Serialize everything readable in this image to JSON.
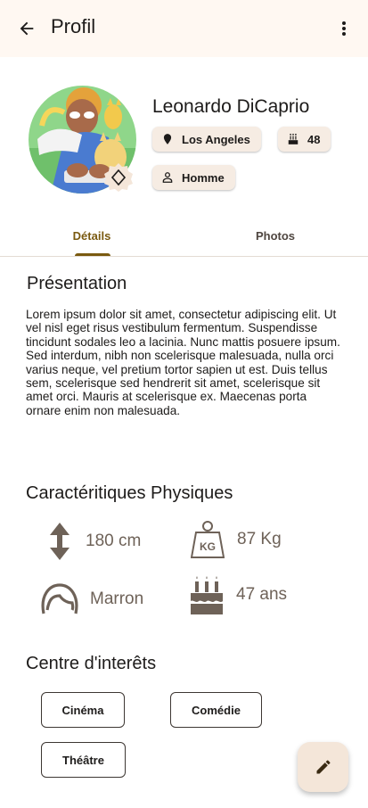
{
  "appbar": {
    "title": "Profil",
    "back_icon": "arrow-left-icon",
    "menu_icon": "more-vert-icon"
  },
  "profile": {
    "name": "Leonardo DiCaprio",
    "avatar_icon": "memoji-avatar",
    "avatar_badge_icon": "edit-photo-icon",
    "chips": {
      "location": {
        "label": "Los Angeles",
        "icon": "location-pin-icon"
      },
      "age": {
        "label": "48",
        "icon": "cake-icon"
      },
      "gender": {
        "label": "Homme",
        "icon": "person-icon"
      }
    }
  },
  "tabs": [
    {
      "label": "Détails",
      "active": true
    },
    {
      "label": "Photos",
      "active": false
    }
  ],
  "presentation": {
    "title": "Présentation",
    "text": "Lorem ipsum dolor sit amet, consectetur adipiscing elit. Ut vel nisl eget risus vestibulum fermentum. Suspendisse tincidunt sodales leo a lacinia. Nunc mattis posuere ipsum. Sed interdum, nibh non scelerisque malesuada, nulla orci varius neque, vel pretium tortor sapien ut est. Duis tellus sem, scelerisque sed hendrerit sit amet, scelerisque sit amet orci. Mauris at scelerisque ex. Maecenas porta ornare enim non malesuada."
  },
  "physical": {
    "title": "Caractéritiques Physiques",
    "height": "180 cm",
    "weight": "87 Kg",
    "hair": "Marron",
    "age": "47 ans"
  },
  "interests": {
    "title": "Centre d'interêts",
    "items": [
      "Cinéma",
      "Comédie",
      "Théâtre"
    ]
  },
  "fab": {
    "icon": "pencil-edit-icon"
  },
  "colors": {
    "appbar_bg": "#fff8f2",
    "accent": "#7a5a10",
    "chip_bg": "#f6ece3",
    "muted_text": "#6e6258",
    "fab_bg": "#f4e6d9"
  }
}
